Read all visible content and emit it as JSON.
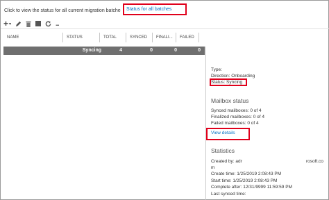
{
  "info_bar": {
    "text": "Click to view the status for all current migration batche",
    "link": "Status for all batches"
  },
  "toolbar": {
    "icons": [
      "plus-icon",
      "chevron-down-icon",
      "pencil-icon",
      "trash-icon",
      "stop-icon",
      "refresh-icon",
      "more-icon"
    ],
    "plus": "+",
    "chevron": "▾",
    "more": "..."
  },
  "grid": {
    "columns": [
      "NAME",
      "STATUS",
      "TOTAL",
      "SYNCED",
      "FINALI...",
      "FAILED"
    ],
    "rows": [
      {
        "name": "",
        "status": "Syncing",
        "total": "4",
        "synced": "0",
        "finalized": "0",
        "failed": "0"
      }
    ]
  },
  "details": {
    "type": "Type:",
    "direction": "Direction: Onboarding",
    "status": "Status: Syncing",
    "mailbox_status_title": "Mailbox status",
    "synced": "Synced mailboxes: 0 of 4",
    "finalized": "Finalized mailboxes: 0 of 4",
    "failed": "Failed mailboxes: 0 of 4",
    "view_details": "View details",
    "statistics_title": "Statistics",
    "created_by": "Created by: adr",
    "created_by_domain": "rosoft.co",
    "created_by_cont": "m",
    "create_time": "Create time: 1/25/2019 2:08:43 PM",
    "start_time": "Start time: 1/25/2019 2:08:43 PM",
    "complete_after": "Complete after: 12/31/9999 11:59:59 PM",
    "last_synced": "Last synced time:"
  },
  "colors": {
    "accent": "#0072c6",
    "highlight": "#e0001b",
    "selected_row": "#6f6f6f"
  }
}
